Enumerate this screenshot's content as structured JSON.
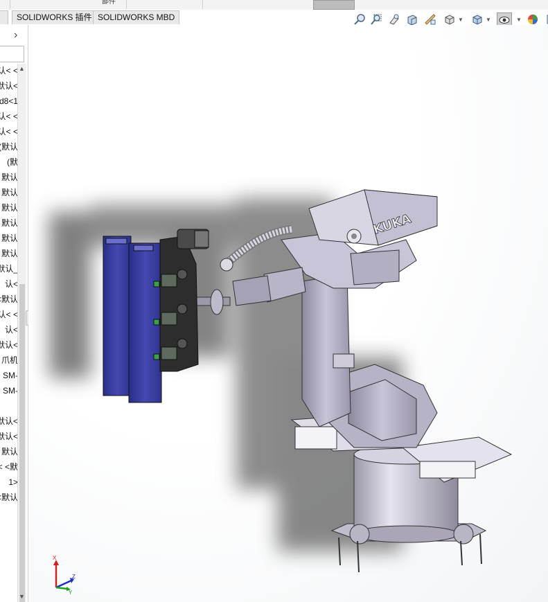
{
  "top_strip": {
    "label_1": "部件",
    "label_2": ""
  },
  "tabs": [
    {
      "label": ""
    },
    {
      "label": "SOLIDWORKS 插件"
    },
    {
      "label": "SOLIDWORKS MBD"
    }
  ],
  "tree": {
    "items": [
      "认< <",
      "默认<",
      "d8<1",
      "认< <",
      "认< <",
      "(默认",
      "(默",
      "默认",
      "默认",
      "默认",
      "默认",
      "默认",
      "默认",
      "默认_",
      "认<",
      "<默认",
      "认< <",
      "认<",
      "默认<",
      "爪机",
      "SM-",
      "SM-",
      "",
      "默认<",
      "默认<",
      "默认",
      "< <默",
      "1>",
      "<默认"
    ]
  },
  "viewport": {
    "robot_brand": "KUKA",
    "triad_x": "X",
    "triad_y": "Y",
    "triad_z": "Z"
  },
  "colors": {
    "gripper_plate": "#3b3fa0",
    "robot_body": "#c4c0d3",
    "shadow": "#6a6a6a"
  },
  "icons": [
    "zoom-to-fit-icon",
    "zoom-area-icon",
    "previous-view-icon",
    "section-view-icon",
    "dynamic-annotation-icon",
    "view-orientation-icon",
    "display-style-icon",
    "hide-show-icon",
    "edit-appearance-icon"
  ]
}
